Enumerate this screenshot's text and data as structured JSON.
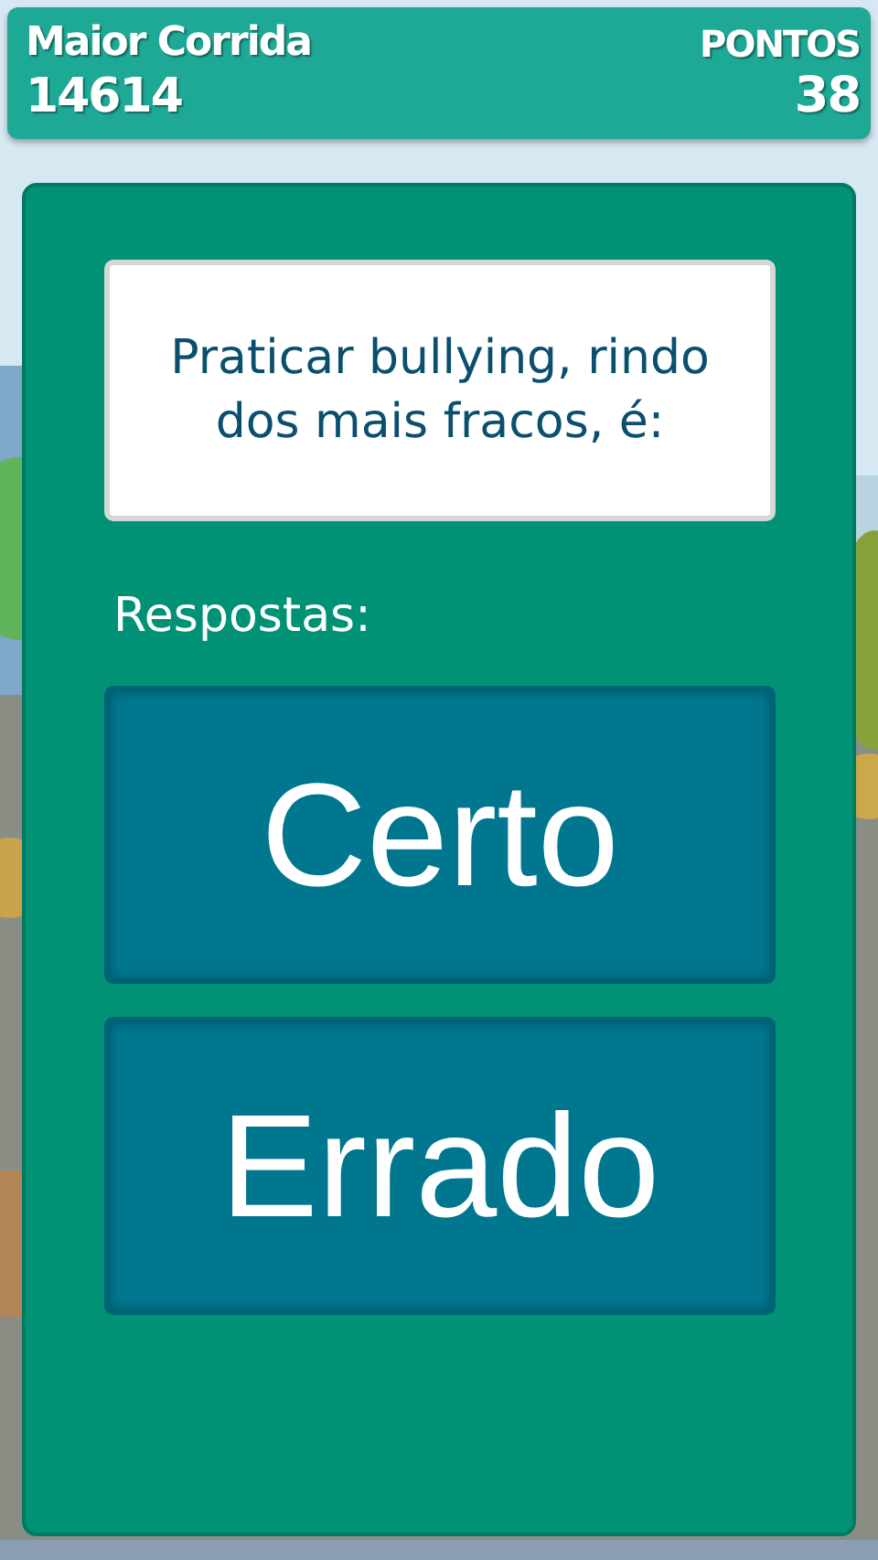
{
  "hud": {
    "best_label": "Maior Corrida",
    "best_value": "14614",
    "points_label": "PONTOS",
    "points_value": "38"
  },
  "question": "Praticar bullying, rindo dos mais fracos, é:",
  "answers_label": "Respostas:",
  "answers": [
    {
      "label": "Certo"
    },
    {
      "label": "Errado"
    }
  ]
}
